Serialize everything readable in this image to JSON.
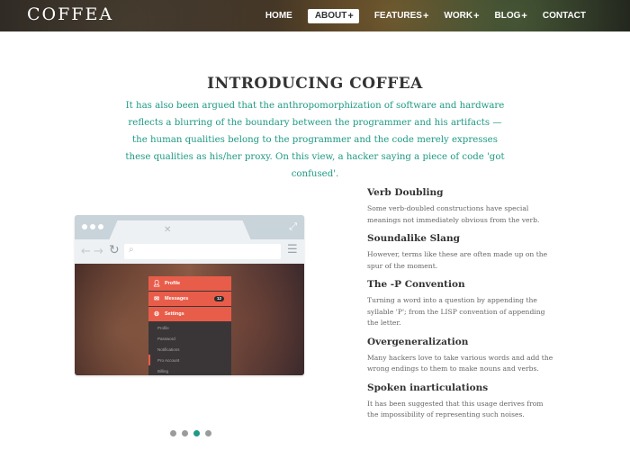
{
  "header": {
    "logo": "COFFEA",
    "nav": [
      {
        "label": "HOME",
        "has_plus": false,
        "active": false
      },
      {
        "label": "ABOUT",
        "has_plus": true,
        "active": true
      },
      {
        "label": "FEATURES",
        "has_plus": true,
        "active": false
      },
      {
        "label": "WORK",
        "has_plus": true,
        "active": false
      },
      {
        "label": "BLOG",
        "has_plus": true,
        "active": false
      },
      {
        "label": "CONTACT",
        "has_plus": false,
        "active": false
      }
    ],
    "plus_glyph": "+"
  },
  "intro": {
    "title": "INTRODUCING COFFEA",
    "text": "It has also been argued that the anthropomorphization of software and hardware reflects a blurring of the boundary between the programmer and his artifacts — the human qualities belong to the programmer and the code merely expresses these qualities as his/her proxy. On this view, a hacker saying a piece of code 'got confused'."
  },
  "mockup": {
    "menu_rows": [
      {
        "icon": "user-icon",
        "label": "Profile"
      },
      {
        "icon": "mail-icon",
        "label": "Messages",
        "badge": "12"
      },
      {
        "icon": "gear-icon",
        "label": "Settings"
      }
    ],
    "submenu": [
      "Profile",
      "Password",
      "Notifications",
      "Pro Account",
      "Billing"
    ]
  },
  "carousel": {
    "count": 4,
    "active_index": 2
  },
  "features": [
    {
      "title": "Verb Doubling",
      "desc": "Some verb-doubled constructions have special meanings not immediately obvious from the verb."
    },
    {
      "title": "Soundalike Slang",
      "desc": "However, terms like these are often made up on the spur of the moment."
    },
    {
      "title": "The -P Convention",
      "desc": "Turning a word into a question by appending the syllable 'P'; from the LISP convention of appending the letter."
    },
    {
      "title": "Overgeneralization",
      "desc": "Many hackers love to take various words and add the wrong endings to them to make nouns and verbs."
    },
    {
      "title": "Spoken inarticulations",
      "desc": "It has been suggested that this usage derives from the impossibility of representing such noises."
    }
  ],
  "colors": {
    "accent": "#1f9a84",
    "menu_red": "#e85d4a",
    "dot_inactive": "#9b9b9b"
  }
}
